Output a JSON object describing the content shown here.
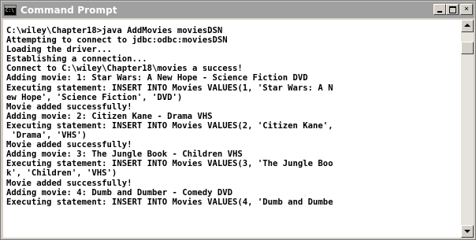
{
  "window": {
    "title": "Command Prompt",
    "icon": "console-icon",
    "buttons": {
      "minimize": "minimize-icon",
      "maximize": "maximize-icon",
      "close": "close-icon"
    }
  },
  "console": {
    "lines": [
      "C:\\wiley\\Chapter18>java AddMovies moviesDSN",
      "Attempting to connect to jdbc:odbc:moviesDSN",
      "Loading the driver...",
      "Establishing a connection...",
      "Connect to C:\\wiley\\Chapter18\\movies a success!",
      "Adding movie: 1: Star Wars: A New Hope - Science Fiction DVD",
      "Executing statement: INSERT INTO Movies VALUES(1, 'Star Wars: A N",
      "ew Hope', 'Science Fiction', 'DVD')",
      "Movie added successfully!",
      "Adding movie: 2: Citizen Kane - Drama VHS",
      "Executing statement: INSERT INTO Movies VALUES(2, 'Citizen Kane',",
      " 'Drama', 'VHS')",
      "Movie added successfully!",
      "Adding movie: 3: The Jungle Book - Children VHS",
      "Executing statement: INSERT INTO Movies VALUES(3, 'The Jungle Boo",
      "k', 'Children', 'VHS')",
      "Movie added successfully!",
      "Adding movie: 4: Dumb and Dumber - Comedy DVD",
      "Executing statement: INSERT INTO Movies VALUES(4, 'Dumb and Dumbe"
    ]
  },
  "scrollbar": {
    "up": "scroll-up-arrow-icon",
    "down": "scroll-down-arrow-icon"
  }
}
